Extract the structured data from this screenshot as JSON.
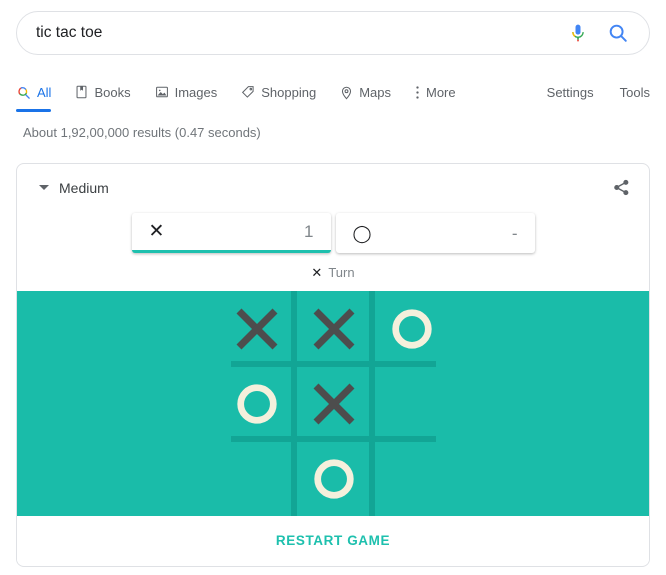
{
  "search": {
    "query": "tic tac toe",
    "placeholder": "Search",
    "mic_icon": "microphone-icon",
    "search_icon": "search-icon"
  },
  "nav": {
    "tabs": [
      {
        "label": "All",
        "icon": "google-search-icon",
        "active": true
      },
      {
        "label": "Books",
        "icon": "book-icon",
        "active": false
      },
      {
        "label": "Images",
        "icon": "image-icon",
        "active": false
      },
      {
        "label": "Shopping",
        "icon": "tag-icon",
        "active": false
      },
      {
        "label": "Maps",
        "icon": "map-pin-icon",
        "active": false
      },
      {
        "label": "More",
        "icon": "more-vertical-icon",
        "active": false
      }
    ],
    "settings_label": "Settings",
    "tools_label": "Tools"
  },
  "results": {
    "count_text": "About 1,92,00,000 results (0.47 seconds)"
  },
  "game": {
    "difficulty": "Medium",
    "share_icon": "share-icon",
    "caret_icon": "caret-down-icon",
    "scores": [
      {
        "mark": "✕",
        "mark_name": "x-mark",
        "value": "1",
        "active": true
      },
      {
        "mark": "◯",
        "mark_name": "o-mark",
        "value": "-",
        "active": false
      }
    ],
    "turn": {
      "mark": "✕",
      "label": "Turn"
    },
    "board": {
      "rows": [
        [
          "X",
          "X",
          "O"
        ],
        [
          "O",
          "X",
          ""
        ],
        [
          "",
          "O",
          ""
        ]
      ]
    },
    "restart_label": "RESTART GAME",
    "colors": {
      "board_bg": "#1abca9",
      "grid_line": "#12a595",
      "x_color": "#4d4d4d",
      "o_color": "#f5f0dc",
      "accent": "#1ec0ae"
    }
  }
}
